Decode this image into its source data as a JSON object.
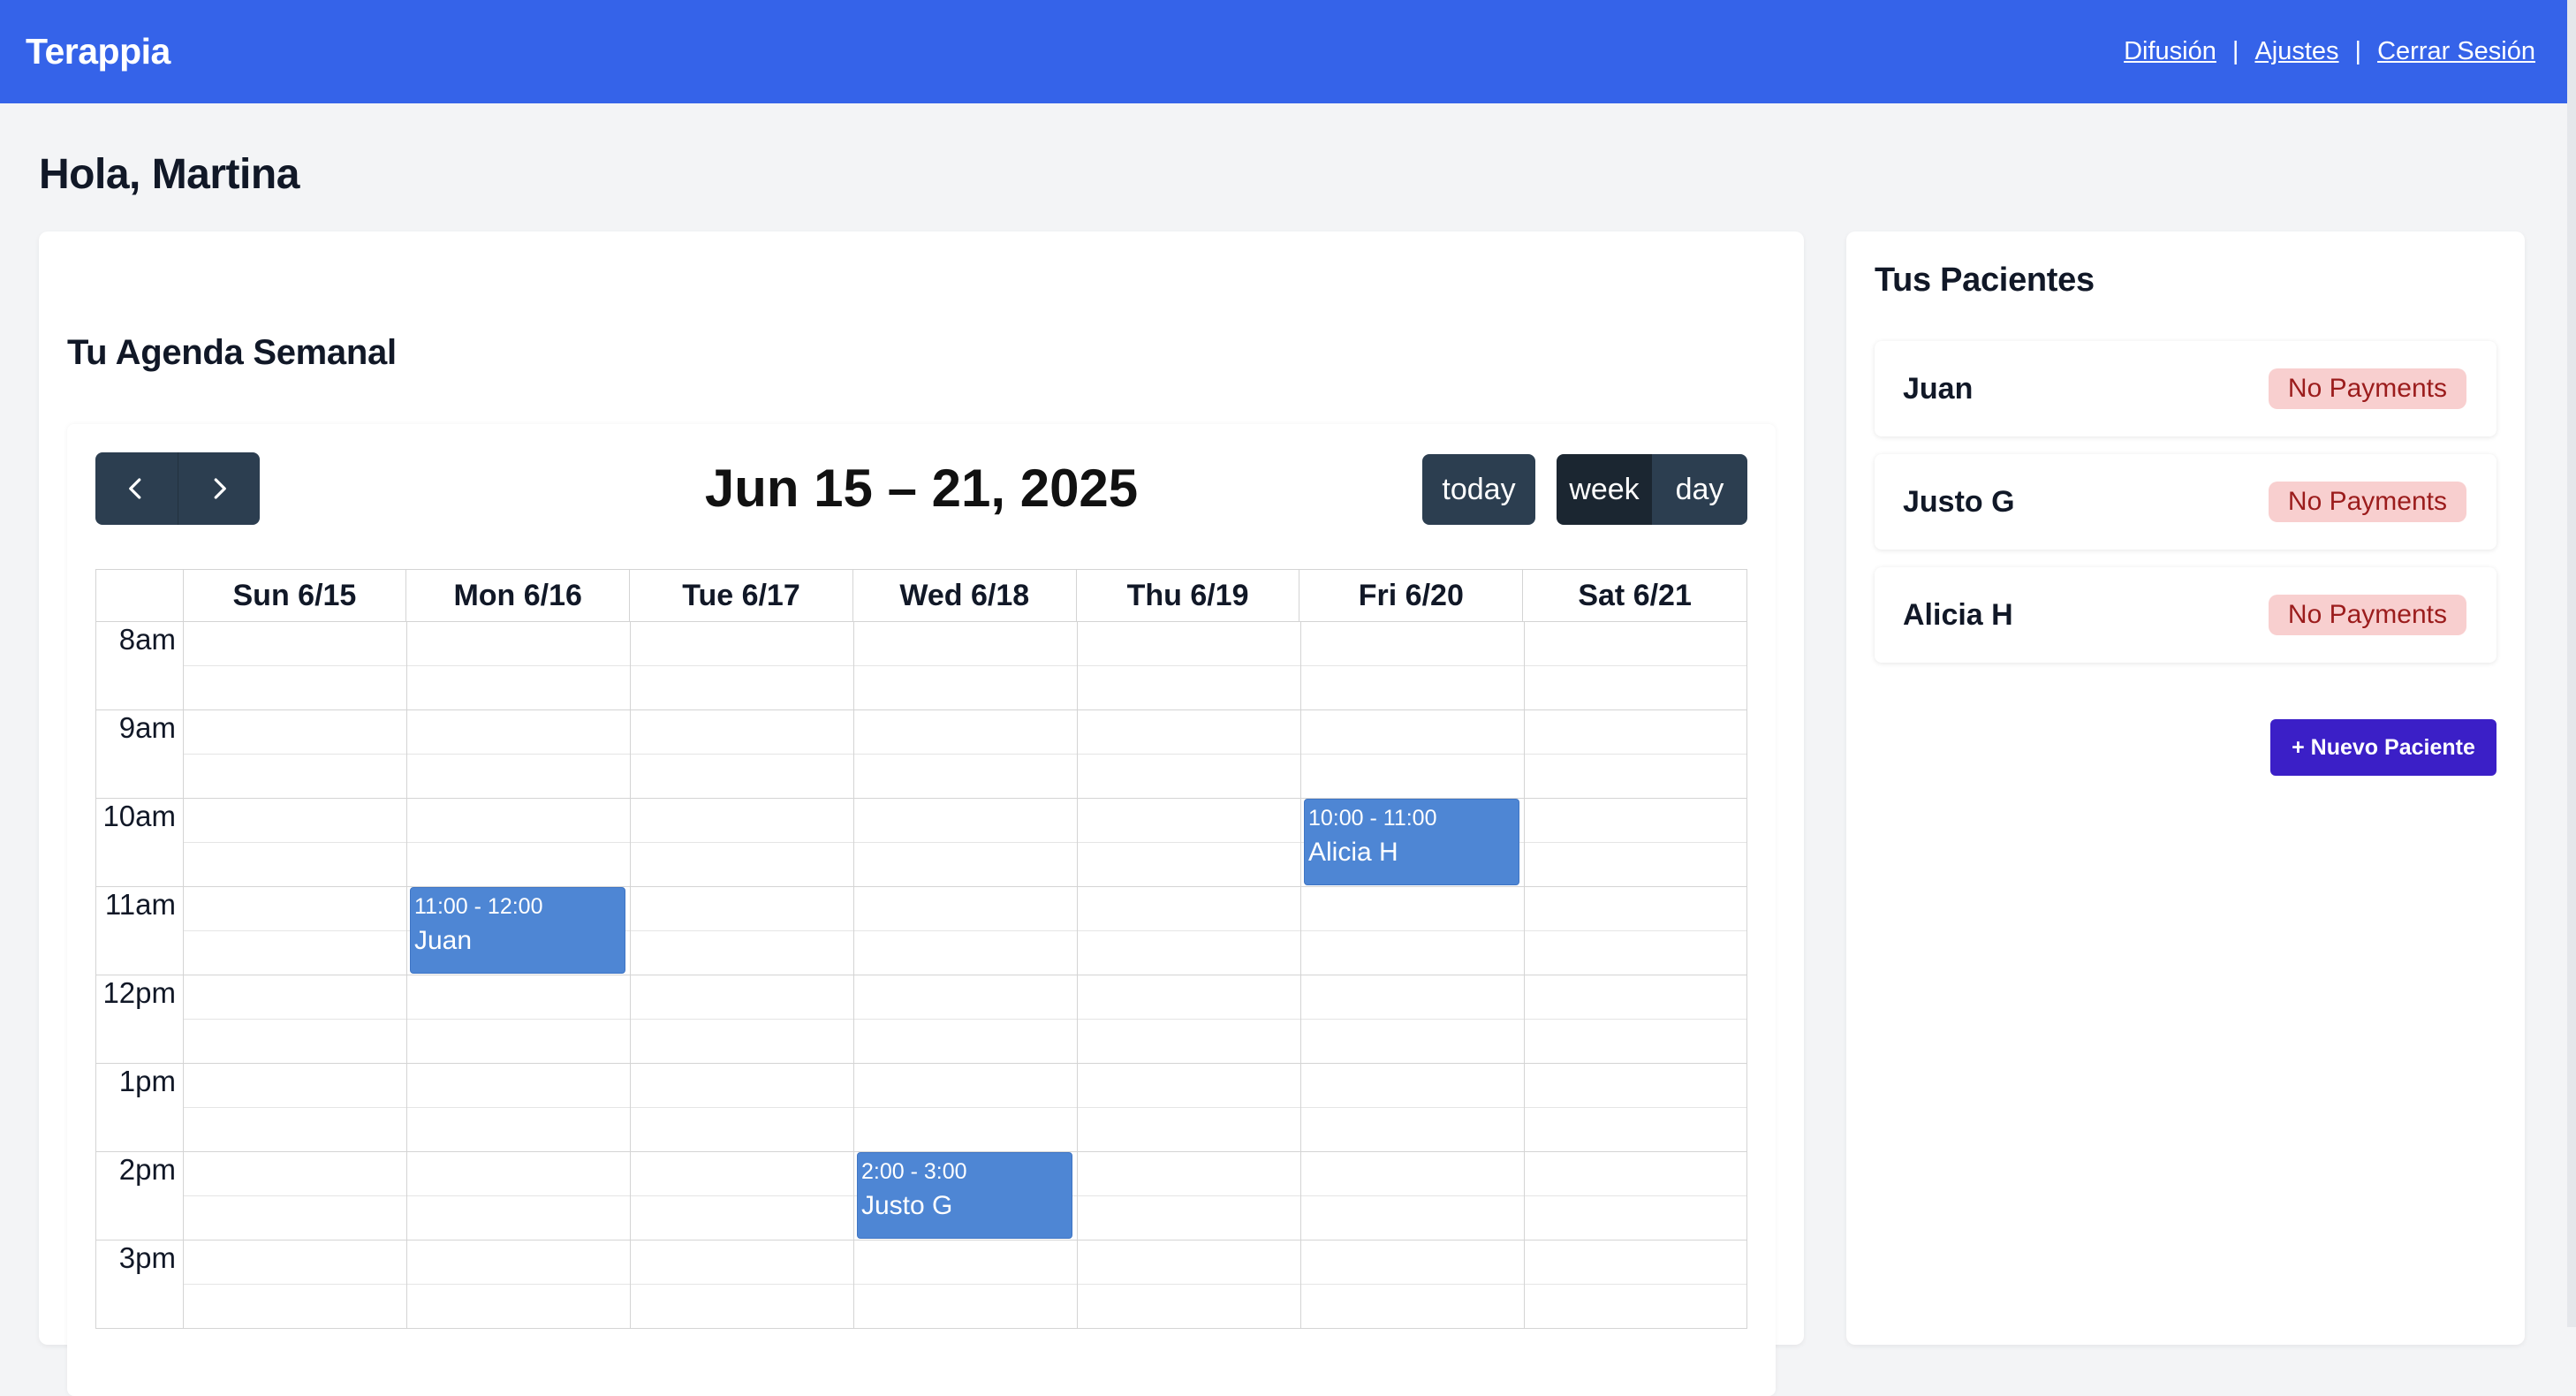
{
  "app": {
    "brand": "Terappia"
  },
  "nav": {
    "links": [
      "Difusión",
      "Ajustes",
      "Cerrar Sesión"
    ],
    "separator": "|"
  },
  "greeting": "Hola, Martina",
  "agenda": {
    "title": "Tu Agenda Semanal",
    "range": "Jun 15 – 21, 2025",
    "buttons": {
      "prev_icon": "chevron-left-icon",
      "next_icon": "chevron-right-icon",
      "today": "today",
      "week": "week",
      "day": "day"
    },
    "active_view": "week",
    "days": [
      "Sun 6/15",
      "Mon 6/16",
      "Tue 6/17",
      "Wed 6/18",
      "Thu 6/19",
      "Fri 6/20",
      "Sat 6/21"
    ],
    "hours": [
      "8am",
      "9am",
      "10am",
      "11am",
      "12pm",
      "1pm",
      "2pm",
      "3pm"
    ],
    "events": [
      {
        "time": "10:00 - 11:00",
        "patient": "Alicia H",
        "day": "Fri 6/20",
        "start": "10:00",
        "end": "11:00"
      },
      {
        "time": "11:00 - 12:00",
        "patient": "Juan",
        "day": "Mon 6/16",
        "start": "11:00",
        "end": "12:00"
      },
      {
        "time": "2:00 - 3:00",
        "patient": "Justo G",
        "day": "Wed 6/18",
        "start": "14:00",
        "end": "15:00"
      }
    ]
  },
  "patients": {
    "title": "Tus Pacientes",
    "items": [
      {
        "name": "Juan",
        "status": "No Payments"
      },
      {
        "name": "Justo G",
        "status": "No Payments"
      },
      {
        "name": "Alicia H",
        "status": "No Payments"
      }
    ],
    "add_label": "+ Nuevo Paciente"
  },
  "colors": {
    "topbar": "#3563e9",
    "event": "#4e86d4",
    "badge_bg": "#f8cfcf",
    "badge_text": "#9b1c1c",
    "add_button": "#3b1fc7",
    "toolbar_button": "#2c3e50"
  }
}
